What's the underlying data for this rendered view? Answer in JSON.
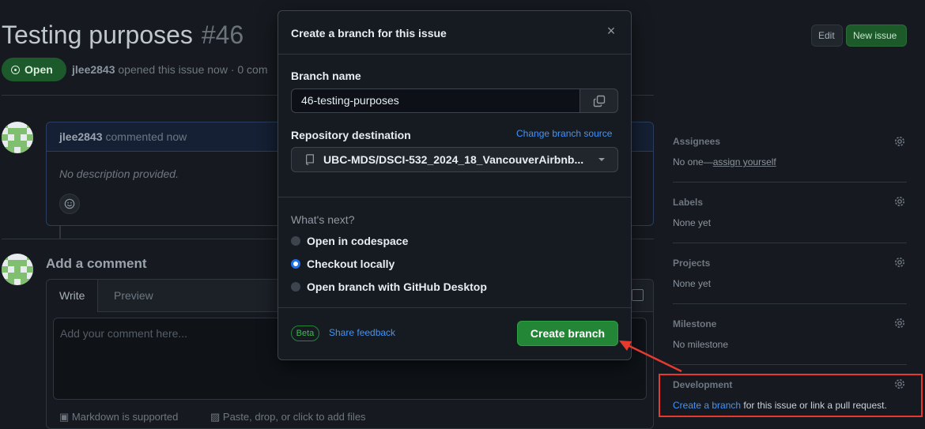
{
  "issue": {
    "title": "Testing purposes",
    "number": "#46",
    "status": "Open",
    "author": "jlee2843",
    "opened_text": " opened this issue now · 0 com",
    "edit_label": "Edit",
    "new_issue_label": "New issue"
  },
  "comment": {
    "author": "jlee2843",
    "meta": "commented now",
    "body": "No description provided.",
    "more": "·"
  },
  "add_comment": {
    "heading": "Add a comment",
    "tab_write": "Write",
    "tab_preview": "Preview",
    "placeholder": "Add your comment here...",
    "markdown_note": "Markdown is supported",
    "paste_note": "Paste, drop, or click to add files"
  },
  "sidebar": {
    "assignees": {
      "heading": "Assignees",
      "value_prefix": "No one—",
      "value_link": "assign yourself"
    },
    "labels": {
      "heading": "Labels",
      "value": "None yet"
    },
    "projects": {
      "heading": "Projects",
      "value": "None yet"
    },
    "milestone": {
      "heading": "Milestone",
      "value": "No milestone"
    },
    "development": {
      "heading": "Development",
      "link": "Create a branch",
      "rest": " for this issue or link a pull request."
    }
  },
  "modal": {
    "title": "Create a branch for this issue",
    "close_glyph": "×",
    "branch_name_label": "Branch name",
    "branch_name_value": "46-testing-purposes",
    "repo_label": "Repository destination",
    "change_source": "Change branch source",
    "repo_value": "UBC-MDS/DSCI-532_2024_18_VancouverAirbnb...",
    "whats_next": "What's next?",
    "options": [
      {
        "label": "Open in codespace",
        "selected": false
      },
      {
        "label": "Checkout locally",
        "selected": true
      },
      {
        "label": "Open branch with GitHub Desktop",
        "selected": false
      }
    ],
    "beta": "Beta",
    "share_feedback": "Share feedback",
    "create_button": "Create branch"
  },
  "colors": {
    "accent_green": "#238636",
    "link_blue": "#4493f8",
    "annotation_red": "#e63a2e"
  }
}
